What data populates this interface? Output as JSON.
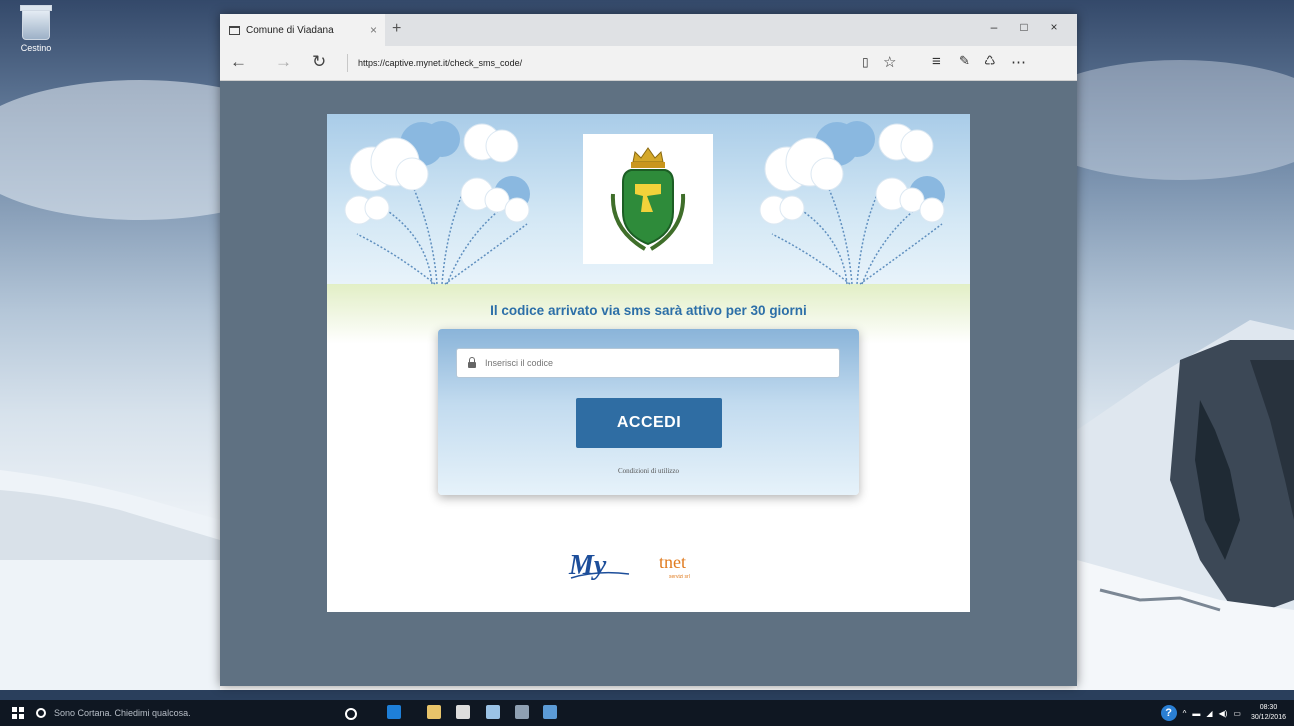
{
  "desktop": {
    "recycle_bin_label": "Cestino"
  },
  "browser": {
    "tab_title": "Comune di Viadana",
    "tab_close": "×",
    "new_tab": "+",
    "minimize": "–",
    "maximize": "□",
    "close": "×",
    "back": "←",
    "forward": "→",
    "refresh": "↻",
    "url": "https://captive.mynet.it/check_sms_code/",
    "toolbar_icons": [
      "reading-view-icon",
      "favorite-star-icon",
      "hub-icon",
      "web-note-icon",
      "share-icon",
      "more-icon"
    ]
  },
  "page": {
    "headline": "Il codice arrivato via sms sarà attivo per 30 giorni",
    "code_placeholder": "Inserisci il codice",
    "login_button": "ACCEDI",
    "terms_link": "Condizioni di utilizzo",
    "footer_logo_text": "tnet",
    "footer_logo_sub": "servizi srl"
  },
  "taskbar": {
    "search_placeholder": "Sono Cortana. Chiedimi qualcosa.",
    "time": "08:30",
    "date": "30/12/2016"
  },
  "colors": {
    "accent_blue": "#2f6da3",
    "headline_blue": "#2c6fa8",
    "window_bg": "#5f7182"
  }
}
